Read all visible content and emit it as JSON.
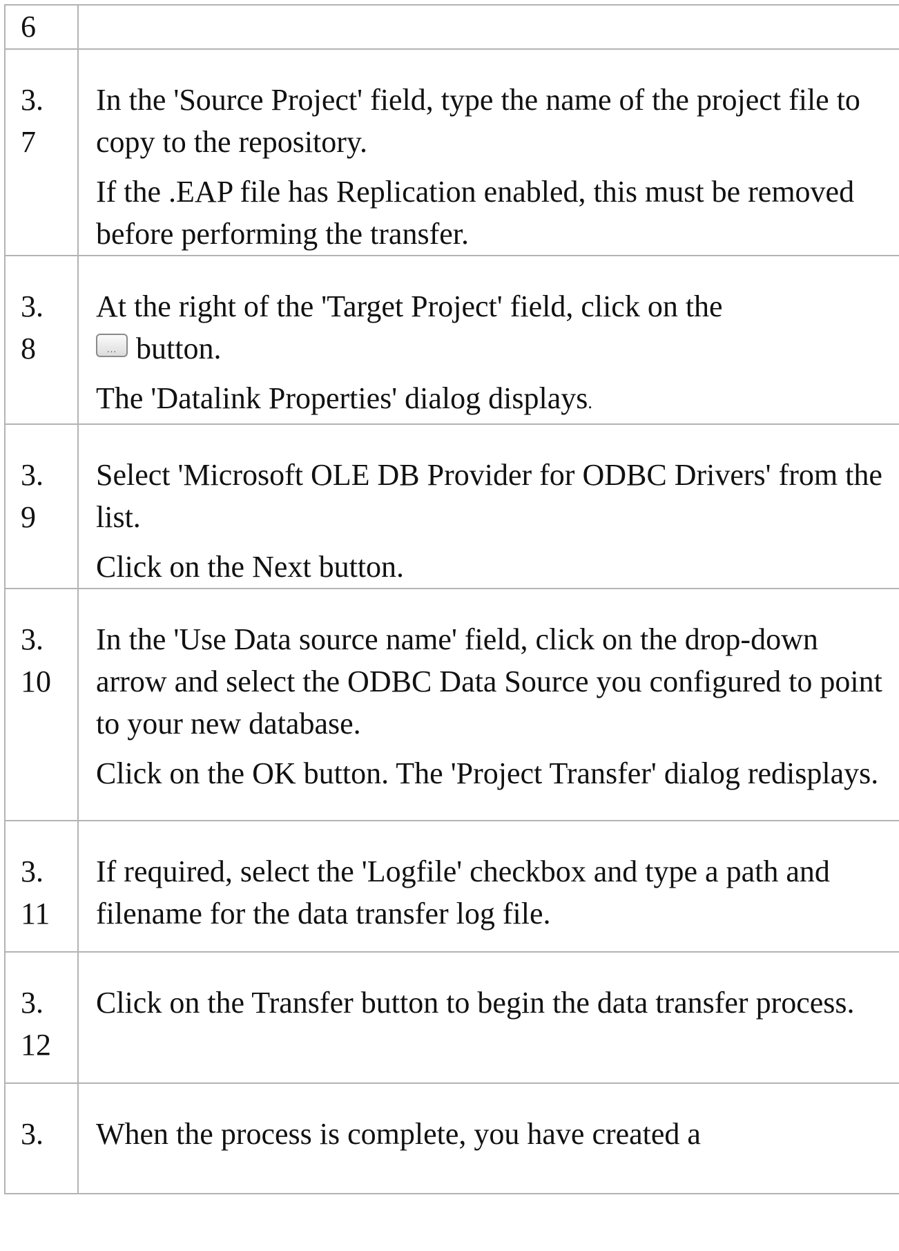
{
  "rows": [
    {
      "number": "6",
      "paragraphs": []
    },
    {
      "number": "3.\n7",
      "paragraphs": [
        "In the 'Source Project' field, type the name of the project file to copy to the repository.",
        "If the .EAP file has Replication enabled, this must be removed before performing the transfer."
      ]
    },
    {
      "number": "3.\n8",
      "paragraph1_before": "At the right of the 'Target Project' field, click on the",
      "button_dots": "...",
      "paragraph1_after": "button.",
      "paragraph2_main": "The 'Datalink Properties' dialog displays",
      "paragraph2_tail": "."
    },
    {
      "number": "3.\n9",
      "paragraphs": [
        "Select 'Microsoft OLE DB Provider for ODBC Drivers' from the list.",
        "Click on the Next button."
      ]
    },
    {
      "number": "3.\n10",
      "paragraphs": [
        "In the 'Use Data source name' field, click on the drop-down arrow and select the ODBC Data Source you configured to point to your new database.",
        "Click on the OK button. The 'Project Transfer' dialog redisplays."
      ]
    },
    {
      "number": "3.\n11",
      "paragraphs": [
        "If required, select the 'Logfile' checkbox and type a path and filename for the data transfer log file."
      ]
    },
    {
      "number": "3.\n12",
      "paragraphs": [
        "Click on the Transfer button to begin the data transfer process."
      ]
    },
    {
      "number": "3.",
      "paragraphs": [
        "When the process is complete, you have created a"
      ]
    }
  ]
}
